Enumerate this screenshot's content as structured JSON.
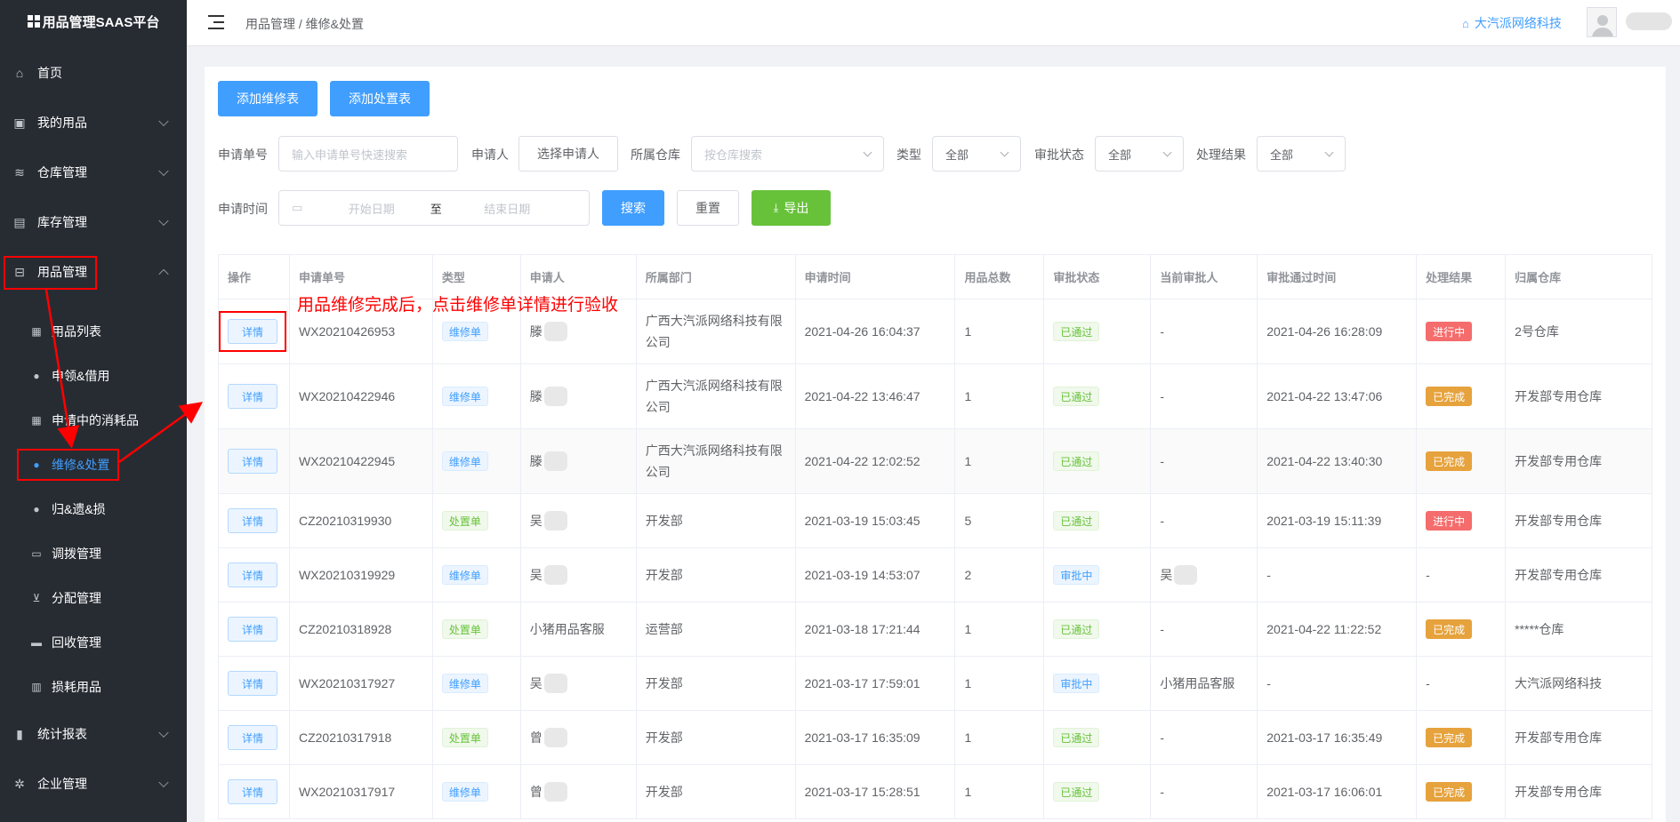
{
  "app": {
    "title": "用品管理SAAS平台"
  },
  "sidebar": {
    "items": [
      {
        "label": "首页",
        "icon": "home-icon",
        "expandable": false
      },
      {
        "label": "我的用品",
        "icon": "bag-icon",
        "expandable": true
      },
      {
        "label": "仓库管理",
        "icon": "database-icon",
        "expandable": true
      },
      {
        "label": "库存管理",
        "icon": "box-icon",
        "expandable": true
      },
      {
        "label": "用品管理",
        "icon": "inbox-icon",
        "expandable": true,
        "expanded": true
      },
      {
        "label": "统计报表",
        "icon": "bar-chart-icon",
        "expandable": true
      },
      {
        "label": "企业管理",
        "icon": "gear-icon",
        "expandable": true
      }
    ],
    "subitems": [
      {
        "label": "用品列表",
        "icon": "clipboard-icon"
      },
      {
        "label": "申领&借用",
        "icon": "user-icon"
      },
      {
        "label": "申请中的消耗品",
        "icon": "clipboard-icon"
      },
      {
        "label": "维修&处置",
        "icon": "user-icon",
        "active": true
      },
      {
        "label": "归&遗&损",
        "icon": "user-icon"
      },
      {
        "label": "调拨管理",
        "icon": "truck-icon"
      },
      {
        "label": "分配管理",
        "icon": "cart-icon"
      },
      {
        "label": "回收管理",
        "icon": "archive-icon"
      },
      {
        "label": "损耗用品",
        "icon": "trash-icon"
      }
    ]
  },
  "header": {
    "breadcrumb": "用品管理 / 维修&处置",
    "company": "大汽派网络科技"
  },
  "toolbar": {
    "add_repair": "添加维修表",
    "add_disposal": "添加处置表"
  },
  "filters": {
    "order_label": "申请单号",
    "order_placeholder": "输入申请单号快速搜索",
    "applicant_label": "申请人",
    "applicant_button": "选择申请人",
    "warehouse_label": "所属仓库",
    "warehouse_placeholder": "按仓库搜索",
    "type_label": "类型",
    "type_value": "全部",
    "approval_label": "审批状态",
    "approval_value": "全部",
    "result_label": "处理结果",
    "result_value": "全部",
    "time_label": "申请时间",
    "start_placeholder": "开始日期",
    "range_sep": "至",
    "end_placeholder": "结束日期",
    "search": "搜索",
    "reset": "重置",
    "export": "导出"
  },
  "annotation": "用品维修完成后，点击维修单详情进行验收",
  "table": {
    "columns": [
      "操作",
      "申请单号",
      "类型",
      "申请人",
      "所属部门",
      "申请时间",
      "用品总数",
      "审批状态",
      "当前审批人",
      "审批通过时间",
      "处理结果",
      "归属仓库"
    ],
    "detail_label": "详情",
    "rows": [
      {
        "order": "WX20210426953",
        "type": "维修单",
        "type_color": "blue",
        "applicant": "滕",
        "dept": "广西大汽派网络科技有限公司",
        "time": "2021-04-26 16:04:37",
        "count": "1",
        "approval": "已通过",
        "approval_color": "green",
        "approver": "-",
        "approved_time": "2021-04-26 16:28:09",
        "result": "进行中",
        "result_color": "red",
        "warehouse": "2号仓库"
      },
      {
        "order": "WX20210422946",
        "type": "维修单",
        "type_color": "blue",
        "applicant": "滕",
        "dept": "广西大汽派网络科技有限公司",
        "time": "2021-04-22 13:46:47",
        "count": "1",
        "approval": "已通过",
        "approval_color": "green",
        "approver": "-",
        "approved_time": "2021-04-22 13:47:06",
        "result": "已完成",
        "result_color": "orange",
        "warehouse": "开发部专用仓库"
      },
      {
        "order": "WX20210422945",
        "type": "维修单",
        "type_color": "blue",
        "applicant": "滕",
        "dept": "广西大汽派网络科技有限公司",
        "time": "2021-04-22 12:02:52",
        "count": "1",
        "approval": "已通过",
        "approval_color": "green",
        "approver": "-",
        "approved_time": "2021-04-22 13:40:30",
        "result": "已完成",
        "result_color": "orange",
        "warehouse": "开发部专用仓库"
      },
      {
        "order": "CZ20210319930",
        "type": "处置单",
        "type_color": "green",
        "applicant": "吴",
        "dept": "开发部",
        "time": "2021-03-19 15:03:45",
        "count": "5",
        "approval": "已通过",
        "approval_color": "green",
        "approver": "-",
        "approved_time": "2021-03-19 15:11:39",
        "result": "进行中",
        "result_color": "red",
        "warehouse": "开发部专用仓库"
      },
      {
        "order": "WX20210319929",
        "type": "维修单",
        "type_color": "blue",
        "applicant": "吴",
        "dept": "开发部",
        "time": "2021-03-19 14:53:07",
        "count": "2",
        "approval": "审批中",
        "approval_color": "blue",
        "approver": "吴",
        "approved_time": "-",
        "result": "-",
        "result_color": "",
        "warehouse": "开发部专用仓库"
      },
      {
        "order": "CZ20210318928",
        "type": "处置单",
        "type_color": "green",
        "applicant": "小猪用品客服",
        "dept": "运营部",
        "time": "2021-03-18 17:21:44",
        "count": "1",
        "approval": "已通过",
        "approval_color": "green",
        "approver": "-",
        "approved_time": "2021-04-22 11:22:52",
        "result": "已完成",
        "result_color": "orange",
        "warehouse": "*****仓库"
      },
      {
        "order": "WX20210317927",
        "type": "维修单",
        "type_color": "blue",
        "applicant": "吴",
        "dept": "开发部",
        "time": "2021-03-17 17:59:01",
        "count": "1",
        "approval": "审批中",
        "approval_color": "blue",
        "approver": "小猪用品客服",
        "approved_time": "-",
        "result": "-",
        "result_color": "",
        "warehouse": "大汽派网络科技"
      },
      {
        "order": "CZ20210317918",
        "type": "处置单",
        "type_color": "green",
        "applicant": "曾",
        "dept": "开发部",
        "time": "2021-03-17 16:35:09",
        "count": "1",
        "approval": "已通过",
        "approval_color": "green",
        "approver": "-",
        "approved_time": "2021-03-17 16:35:49",
        "result": "已完成",
        "result_color": "orange",
        "warehouse": "开发部专用仓库"
      },
      {
        "order": "WX20210317917",
        "type": "维修单",
        "type_color": "blue",
        "applicant": "曾",
        "dept": "开发部",
        "time": "2021-03-17 15:28:51",
        "count": "1",
        "approval": "已通过",
        "approval_color": "green",
        "approver": "-",
        "approved_time": "2021-03-17 16:06:01",
        "result": "已完成",
        "result_color": "orange",
        "warehouse": "开发部专用仓库"
      }
    ]
  },
  "colors": {
    "primary": "#409eff",
    "sidebar": "#272c33",
    "success": "#67c23a",
    "danger": "#f56c6c",
    "warning": "#e6a23c",
    "annotation": "#ff0000"
  }
}
